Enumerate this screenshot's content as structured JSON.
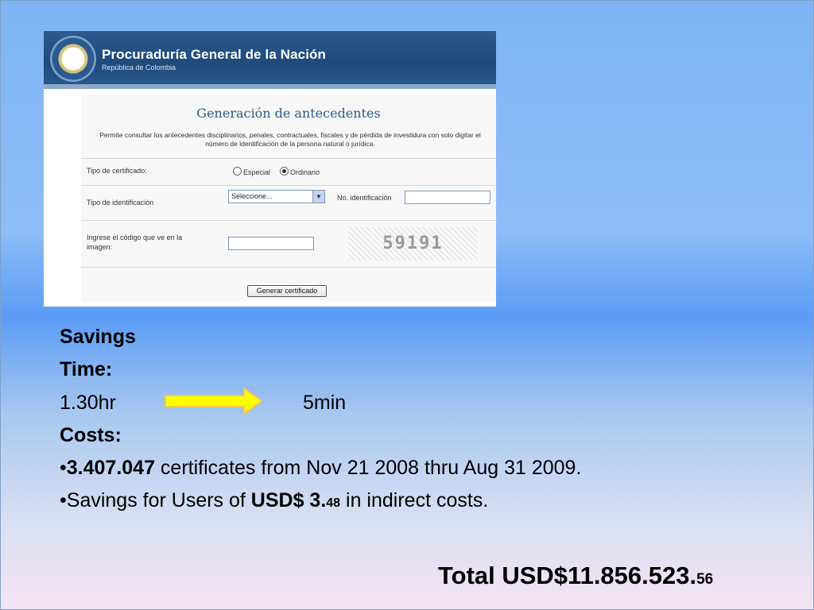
{
  "screenshot": {
    "org_name": "Procuraduría General de la Nación",
    "org_subtitle": "República de Colombia",
    "form_title": "Generación de antecedentes",
    "form_description": "Permite consultar los antecedentes disciplinarios, penales, contractuales, fiscales y de pérdida de investidura con solo digitar el número de identificación de la persona natural o jurídica.",
    "cert_type_label": "Tipo de certificado:",
    "radio_especial": "Especial",
    "radio_ordinario": "Ordinario",
    "selected_cert_type": "Ordinario",
    "id_type_label": "Tipo de identificación",
    "id_type_select_value": "Seleccione...",
    "id_number_label": "No. identificación",
    "id_number_value": "",
    "captcha_label": "Ingrese el código que ve en la imagen:",
    "captcha_input_value": "",
    "captcha_text": "59191",
    "generate_button": "Generar certificado"
  },
  "slide": {
    "heading1": "Savings",
    "heading2": "Time:",
    "time_before": "1.30hr",
    "time_after": "5min",
    "costs_label": "Costs:",
    "bullet1_bold": "3.407.047",
    "bullet1_rest": " certificates from Nov 21 2008 thru Aug 31 2009.",
    "bullet2_start": "Savings for Users of ",
    "bullet2_bold": "USD$ 3.",
    "bullet2_small": "48",
    "bullet2_end": " in indirect  costs.",
    "bullet_char": "•",
    "total_main": "Total USD$11.856.523.",
    "total_cents": "56"
  },
  "colors": {
    "header_blue": "#1f4a7c",
    "title_blue": "#2d5b8e",
    "arrow_fill": "#ffff00",
    "arrow_stroke": "#f2c94c"
  }
}
